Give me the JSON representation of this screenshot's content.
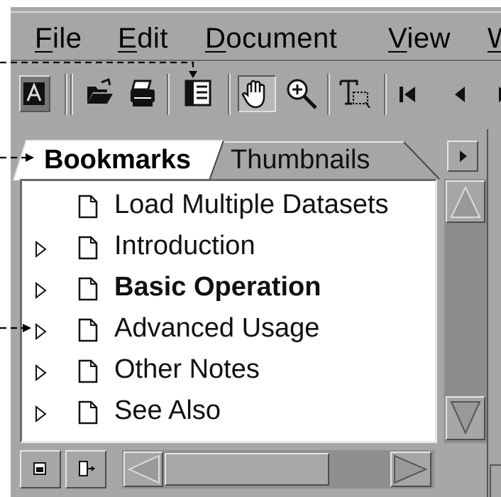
{
  "menubar": {
    "items": [
      {
        "label": "File",
        "underline": "F",
        "rest": "ile"
      },
      {
        "label": "Edit",
        "underline": "E",
        "rest": "dit"
      },
      {
        "label": "Document",
        "underline": "D",
        "rest": "ocument"
      },
      {
        "label": "View",
        "underline": "V",
        "rest": "iew"
      },
      {
        "label": "Window",
        "underline": "W",
        "rest": ""
      }
    ]
  },
  "toolbar": {
    "icons": [
      "acrobat-logo-icon",
      "open-folder-icon",
      "print-icon",
      "show-navigation-pane-icon",
      "hand-tool-icon",
      "zoom-in-icon",
      "text-select-icon",
      "first-page-icon",
      "previous-page-icon",
      "next-page-icon"
    ]
  },
  "navigation_pane": {
    "tabs": [
      {
        "label": "Bookmarks",
        "active": true
      },
      {
        "label": "Thumbnails",
        "active": false
      }
    ],
    "bookmarks": [
      {
        "label": "Load Multiple Datasets",
        "expandable": false,
        "bold": false
      },
      {
        "label": "Introduction",
        "expandable": true,
        "bold": false
      },
      {
        "label": "Basic Operation",
        "expandable": true,
        "bold": true
      },
      {
        "label": "Advanced Usage",
        "expandable": true,
        "bold": false
      },
      {
        "label": "Other Notes",
        "expandable": true,
        "bold": false
      },
      {
        "label": "See Also",
        "expandable": true,
        "bold": false
      }
    ]
  },
  "colors": {
    "chrome": "#a6a6a6",
    "panel": "#ffffff",
    "scroll_trough": "#8d8d8d"
  }
}
